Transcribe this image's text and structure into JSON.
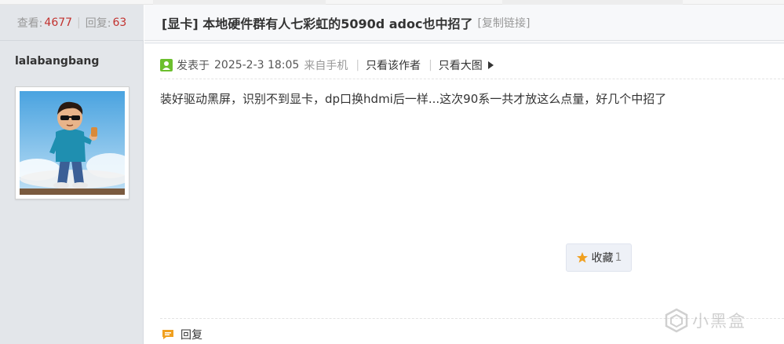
{
  "stats": {
    "views_label": "查看:",
    "views_value": "4677",
    "separator": "|",
    "replies_label": "回复:",
    "replies_value": "63"
  },
  "thread": {
    "title": "[显卡] 本地硬件群有人七彩虹的5090d adoc也中招了",
    "copy_link": "[复制链接]"
  },
  "author": {
    "name": "lalabangbang",
    "avatar_icon": "cartoon-boy-sunglasses-avatar"
  },
  "post": {
    "posted_label": "发表于",
    "date": "2025-2-3 18:05",
    "source": "来自手机",
    "pipe": "|",
    "only_author": "只看该作者",
    "view_large": "只看大图",
    "body": "装好驱动黑屏，识别不到显卡，dp口换hdmi后一样...这次90系一共才放这么点量，好几个中招了"
  },
  "actions": {
    "favorite_label": "收藏",
    "favorite_count": "1",
    "reply_label": "回复"
  },
  "watermark": {
    "text": "小黑盒"
  },
  "colors": {
    "accent_red": "#c2322f",
    "star_orange": "#f0a020",
    "reply_orange": "#f0a020",
    "sidebar_bg": "#e3e6ea"
  }
}
